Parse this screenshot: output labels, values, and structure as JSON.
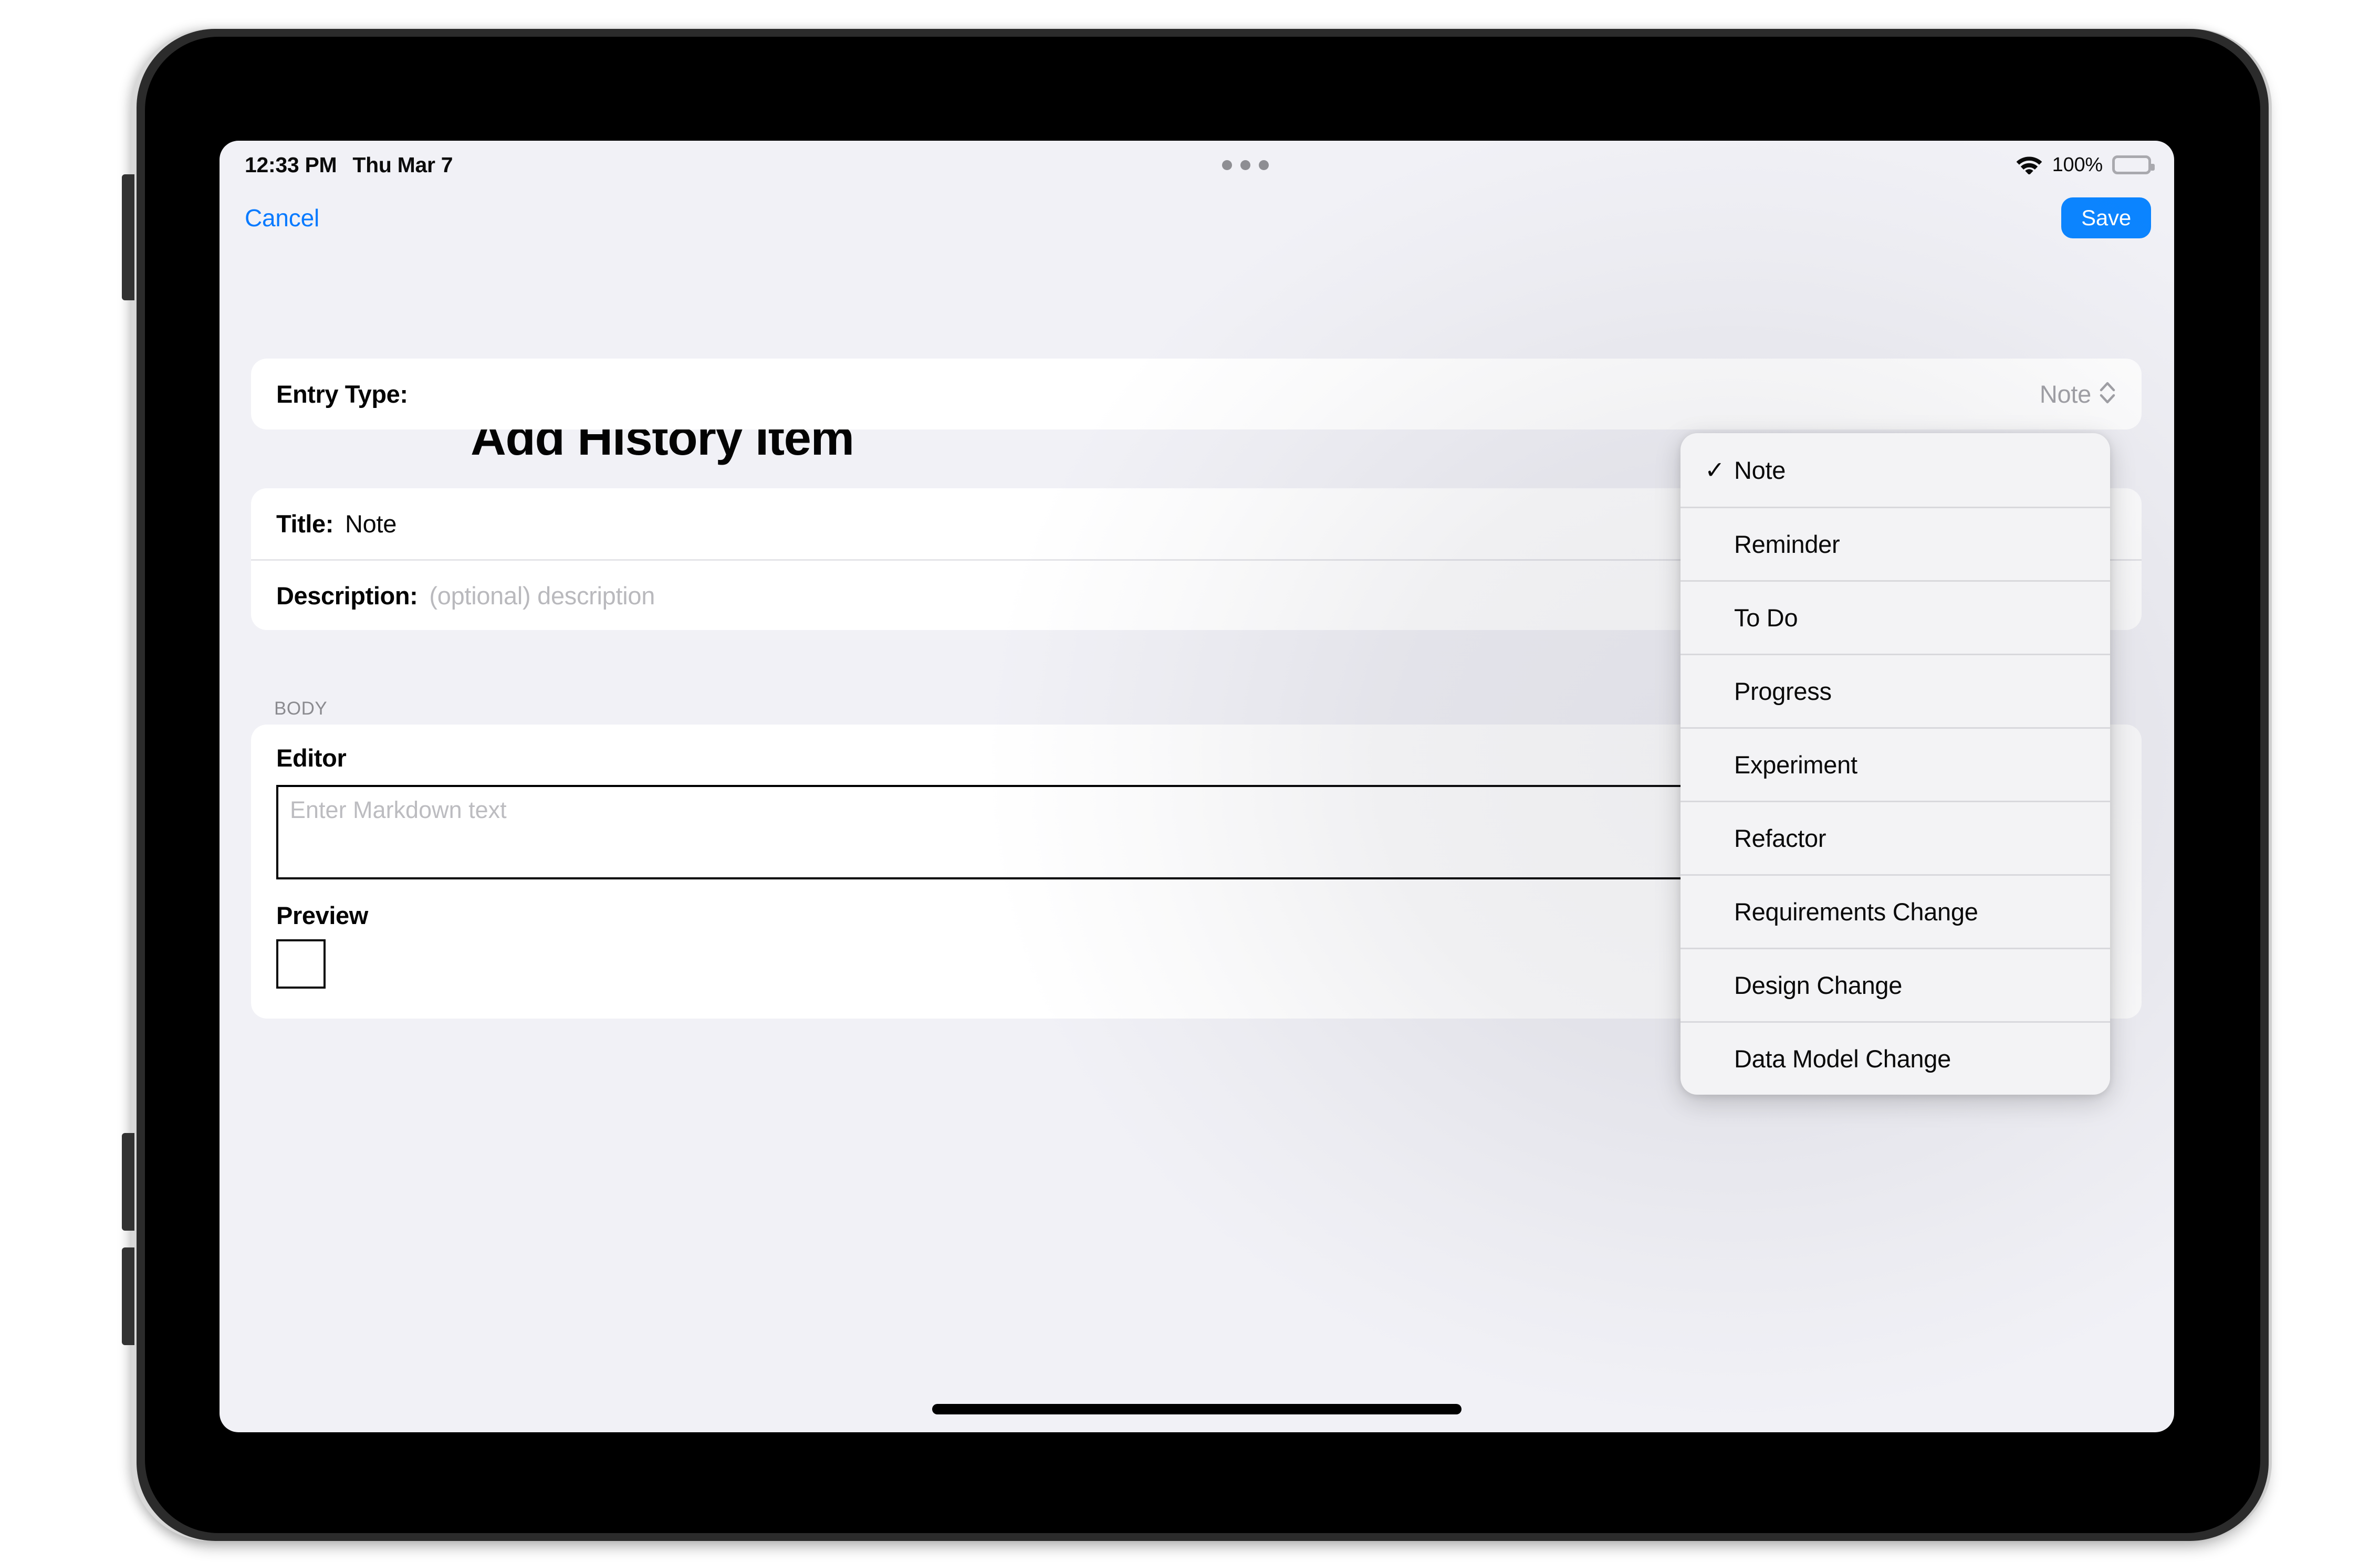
{
  "status_bar": {
    "time": "12:33 PM",
    "date": "Thu Mar 7",
    "wifi_icon": "wifi-icon",
    "battery_percent": "100%",
    "battery_icon": "battery-full-icon",
    "multitask_handle_icon": "three-dots-icon"
  },
  "nav_bar": {
    "cancel_label": "Cancel",
    "save_label": "Save",
    "accent_color": "#0b84ff",
    "link_color": "#087aff"
  },
  "page": {
    "title": "Add History Item"
  },
  "form": {
    "entry_type": {
      "label": "Entry Type:",
      "value": "Note",
      "chevron_icon": "up-down-chevron-icon"
    },
    "title_field": {
      "label": "Title:",
      "value": "Note"
    },
    "description_field": {
      "label": "Description:",
      "placeholder": "(optional) description"
    },
    "body_section": {
      "header": "BODY",
      "editor_label": "Editor",
      "editor_placeholder": "Enter Markdown text",
      "editor_value": "",
      "preview_label": "Preview"
    }
  },
  "entry_type_menu": {
    "checkmark_icon": "checkmark-icon",
    "selected": "Note",
    "items": [
      {
        "label": "Note",
        "checked": "✓"
      },
      {
        "label": "Reminder",
        "checked": ""
      },
      {
        "label": "To Do",
        "checked": ""
      },
      {
        "label": "Progress",
        "checked": ""
      },
      {
        "label": "Experiment",
        "checked": ""
      },
      {
        "label": "Refactor",
        "checked": ""
      },
      {
        "label": "Requirements Change",
        "checked": ""
      },
      {
        "label": "Design Change",
        "checked": ""
      },
      {
        "label": "Data Model Change",
        "checked": ""
      }
    ]
  },
  "device": {
    "home_indicator": "home-indicator",
    "side_buttons": [
      "volume-up-button",
      "volume-down-button",
      "power-button"
    ]
  }
}
